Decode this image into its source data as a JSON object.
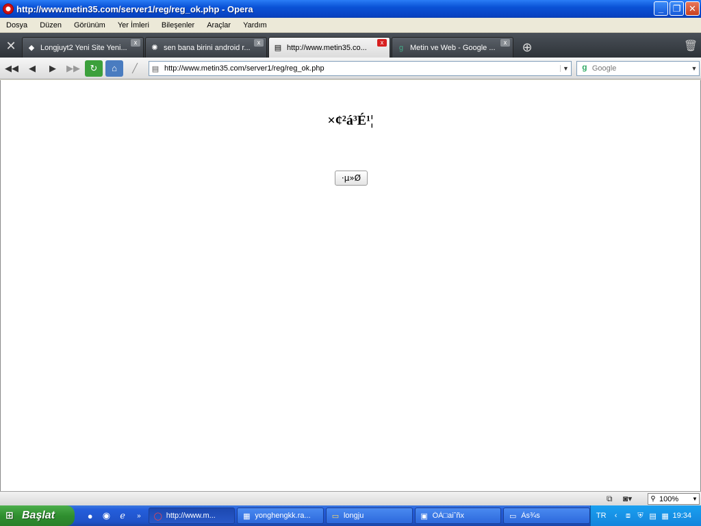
{
  "window": {
    "title": "http://www.metin35.com/server1/reg/reg_ok.php - Opera",
    "minimize": "_",
    "restore": "❐",
    "close": "✕"
  },
  "menu": [
    "Dosya",
    "Düzen",
    "Görünüm",
    "Yer İmleri",
    "Bileşenler",
    "Araçlar",
    "Yardım"
  ],
  "tabs": [
    {
      "label": "Longjuyt2 Yeni Site Yeni...",
      "active": false
    },
    {
      "label": "sen bana birini android r...",
      "active": false
    },
    {
      "label": "http://www.metin35.co...",
      "active": true
    },
    {
      "label": "Metin ve Web - Google ...",
      "active": false
    }
  ],
  "toolbar": {
    "address": "http://www.metin35.com/server1/reg/reg_ok.php",
    "search_placeholder": "Google"
  },
  "page": {
    "heading": "×¢²á³É¹¦",
    "button": "·µ»Ø"
  },
  "statusbar": {
    "zoom": "100%"
  },
  "taskbar": {
    "start": "Başlat",
    "items": [
      {
        "label": "http://www.m...",
        "active": true
      },
      {
        "label": "yonghengkk.ra...",
        "active": false
      },
      {
        "label": "longju",
        "active": false
      },
      {
        "label": "ÓÀ□aiˆñx",
        "active": false
      },
      {
        "label": "Às¾s",
        "active": false
      }
    ],
    "language": "TR",
    "clock": "19:34"
  },
  "colors": {
    "titlebar": "#0a52d6",
    "taskbar": "#245edb",
    "start": "#2f8f2f",
    "active_tab_close": "#d82020"
  }
}
